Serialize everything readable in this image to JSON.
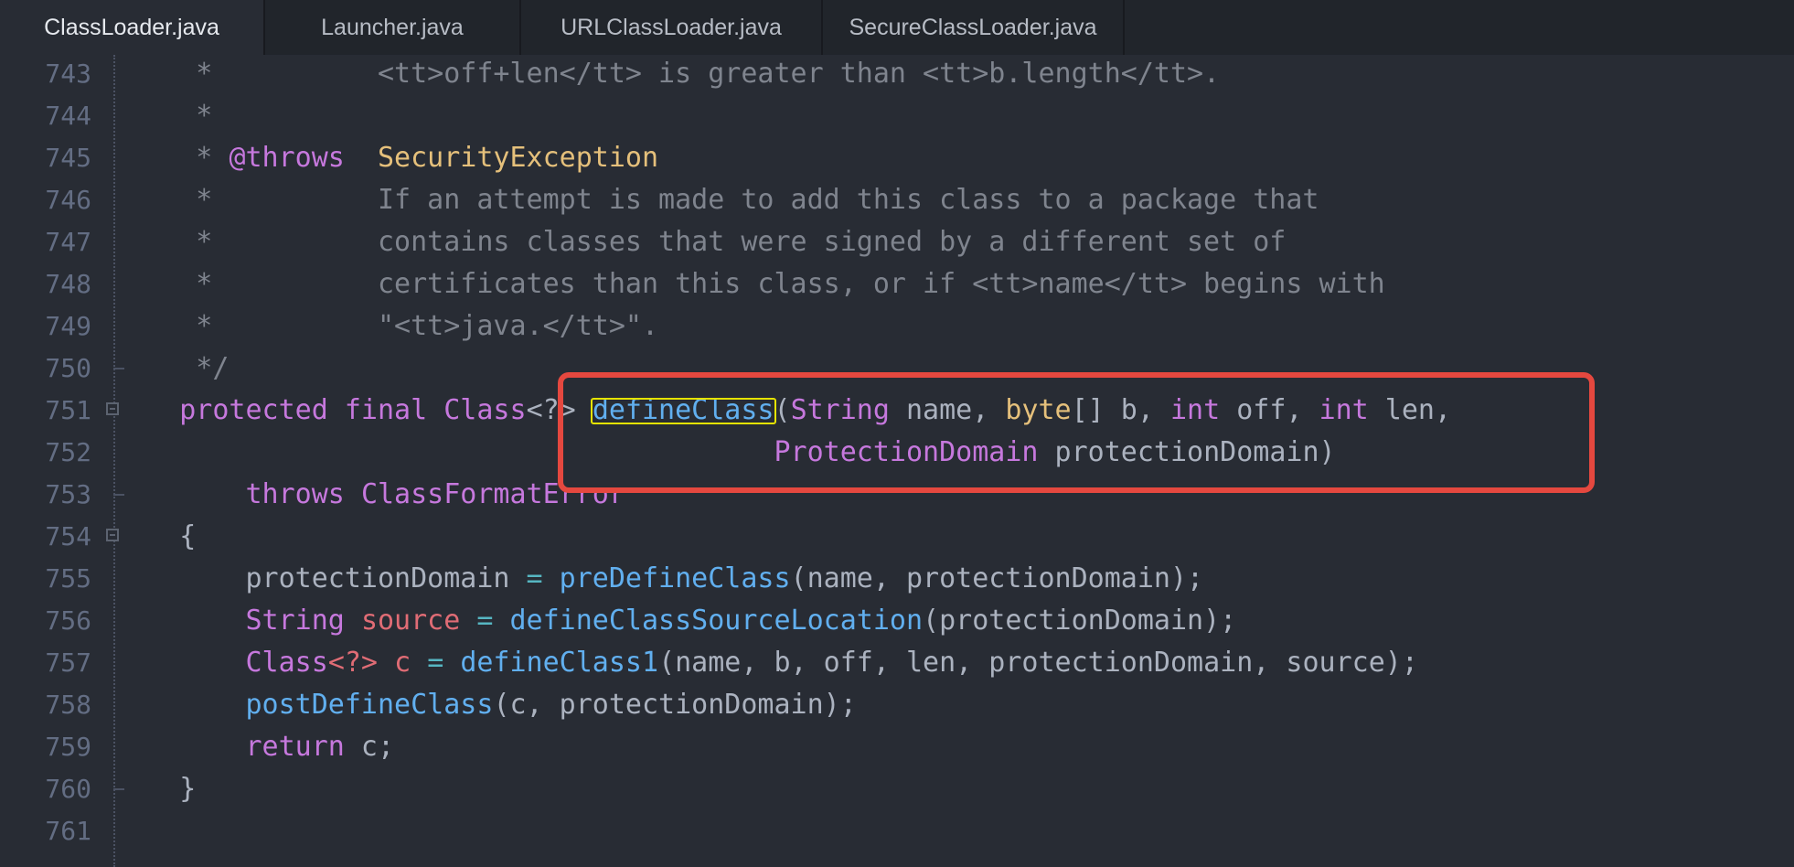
{
  "tabs": [
    {
      "label": "ClassLoader.java",
      "active": true
    },
    {
      "label": "Launcher.java",
      "active": false
    },
    {
      "label": "URLClassLoader.java",
      "active": false
    },
    {
      "label": "SecureClassLoader.java",
      "active": false
    }
  ],
  "lines": [
    {
      "num": "743",
      "fold": "",
      "tokens": [
        {
          "t": "     *          <tt>off+len</tt> is greater than <tt>b.length</tt>.",
          "c": "c-com"
        }
      ]
    },
    {
      "num": "744",
      "fold": "",
      "tokens": [
        {
          "t": "     *",
          "c": "c-com"
        }
      ]
    },
    {
      "num": "745",
      "fold": "",
      "tokens": [
        {
          "t": "     * ",
          "c": "c-com"
        },
        {
          "t": "@throws",
          "c": "c-tag"
        },
        {
          "t": "  ",
          "c": "c-com"
        },
        {
          "t": "SecurityException",
          "c": "c-exc"
        }
      ]
    },
    {
      "num": "746",
      "fold": "",
      "tokens": [
        {
          "t": "     *          If an attempt is made to add this class to a package that",
          "c": "c-com"
        }
      ]
    },
    {
      "num": "747",
      "fold": "",
      "tokens": [
        {
          "t": "     *          contains classes that were signed by a different set of",
          "c": "c-com"
        }
      ]
    },
    {
      "num": "748",
      "fold": "",
      "tokens": [
        {
          "t": "     *          certificates than this class, or if <tt>name</tt> begins with",
          "c": "c-com"
        }
      ]
    },
    {
      "num": "749",
      "fold": "",
      "tokens": [
        {
          "t": "     *          \"<tt>java.</tt>\".",
          "c": "c-com"
        }
      ]
    },
    {
      "num": "750",
      "fold": "end",
      "tokens": [
        {
          "t": "     */",
          "c": "c-com"
        }
      ]
    },
    {
      "num": "751",
      "fold": "start",
      "tokens": [
        {
          "t": "    ",
          "c": "c-pl"
        },
        {
          "t": "protected",
          "c": "c-kw"
        },
        {
          "t": " ",
          "c": "c-pl"
        },
        {
          "t": "final",
          "c": "c-kw"
        },
        {
          "t": " ",
          "c": "c-pl"
        },
        {
          "t": "Class",
          "c": "c-ty"
        },
        {
          "t": "<?>",
          "c": "c-pl"
        },
        {
          "t": " ",
          "c": "c-pl"
        },
        {
          "t": "defineClass",
          "c": "c-fn"
        },
        {
          "t": "(",
          "c": "c-pl"
        },
        {
          "t": "String",
          "c": "c-ty"
        },
        {
          "t": " name, ",
          "c": "c-pl"
        },
        {
          "t": "byte",
          "c": "c-yl"
        },
        {
          "t": "[] b, ",
          "c": "c-pl"
        },
        {
          "t": "int",
          "c": "c-kw"
        },
        {
          "t": " off, ",
          "c": "c-pl"
        },
        {
          "t": "int",
          "c": "c-kw"
        },
        {
          "t": " len,",
          "c": "c-pl"
        }
      ]
    },
    {
      "num": "752",
      "fold": "",
      "tokens": [
        {
          "t": "                                        ",
          "c": "c-pl"
        },
        {
          "t": "ProtectionDomain",
          "c": "c-ty"
        },
        {
          "t": " protectionDomain)",
          "c": "c-pl"
        }
      ]
    },
    {
      "num": "753",
      "fold": "end",
      "tokens": [
        {
          "t": "        ",
          "c": "c-pl"
        },
        {
          "t": "throws",
          "c": "c-kw"
        },
        {
          "t": " ",
          "c": "c-pl"
        },
        {
          "t": "ClassFormatError",
          "c": "c-ty"
        }
      ]
    },
    {
      "num": "754",
      "fold": "start",
      "tokens": [
        {
          "t": "    {",
          "c": "c-pl"
        }
      ]
    },
    {
      "num": "755",
      "fold": "",
      "tokens": [
        {
          "t": "        protectionDomain ",
          "c": "c-pl"
        },
        {
          "t": "=",
          "c": "c-op"
        },
        {
          "t": " ",
          "c": "c-pl"
        },
        {
          "t": "preDefineClass",
          "c": "c-fn"
        },
        {
          "t": "(name, protectionDomain);",
          "c": "c-pl"
        }
      ]
    },
    {
      "num": "756",
      "fold": "",
      "tokens": [
        {
          "t": "        ",
          "c": "c-pl"
        },
        {
          "t": "String",
          "c": "c-ty"
        },
        {
          "t": " ",
          "c": "c-pl"
        },
        {
          "t": "source",
          "c": "c-var"
        },
        {
          "t": " ",
          "c": "c-pl"
        },
        {
          "t": "=",
          "c": "c-op"
        },
        {
          "t": " ",
          "c": "c-pl"
        },
        {
          "t": "defineClassSourceLocation",
          "c": "c-fn"
        },
        {
          "t": "(protectionDomain);",
          "c": "c-pl"
        }
      ]
    },
    {
      "num": "757",
      "fold": "",
      "tokens": [
        {
          "t": "        ",
          "c": "c-pl"
        },
        {
          "t": "Class",
          "c": "c-ty"
        },
        {
          "t": "<?>",
          "c": "c-var"
        },
        {
          "t": " ",
          "c": "c-pl"
        },
        {
          "t": "c",
          "c": "c-var"
        },
        {
          "t": " ",
          "c": "c-pl"
        },
        {
          "t": "=",
          "c": "c-op"
        },
        {
          "t": " ",
          "c": "c-pl"
        },
        {
          "t": "defineClass1",
          "c": "c-fn"
        },
        {
          "t": "(name, b, off, len, protectionDomain, source);",
          "c": "c-pl"
        }
      ]
    },
    {
      "num": "758",
      "fold": "",
      "tokens": [
        {
          "t": "        ",
          "c": "c-pl"
        },
        {
          "t": "postDefineClass",
          "c": "c-fn"
        },
        {
          "t": "(c, protectionDomain);",
          "c": "c-pl"
        }
      ]
    },
    {
      "num": "759",
      "fold": "",
      "tokens": [
        {
          "t": "        ",
          "c": "c-pl"
        },
        {
          "t": "return",
          "c": "c-kw"
        },
        {
          "t": " c;",
          "c": "c-pl"
        }
      ]
    },
    {
      "num": "760",
      "fold": "end",
      "tokens": [
        {
          "t": "    }",
          "c": "c-pl"
        }
      ]
    },
    {
      "num": "761",
      "fold": "",
      "tokens": []
    }
  ],
  "colors": {
    "background": "#282c34",
    "tabbar": "#21252b",
    "highlight_box": "#e5e300",
    "annotation_box": "#e5483f"
  }
}
